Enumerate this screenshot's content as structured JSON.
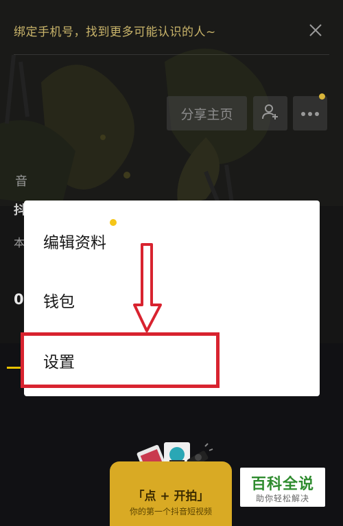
{
  "banner": {
    "text": "绑定手机号，找到更多可能认识的人~",
    "close_icon": "close-icon"
  },
  "actions": {
    "share_label": "分享主页",
    "add_friend_icon": "add-friend-icon",
    "more_icon": "more-icon"
  },
  "profile": {
    "fragments": [
      "音",
      "抖",
      "本",
      "0"
    ]
  },
  "menu": {
    "items": [
      {
        "label": "编辑资料"
      },
      {
        "label": "钱包"
      },
      {
        "label": "设置"
      }
    ]
  },
  "bottom_card": {
    "title": "「点 + 开拍」",
    "subtitle": "你的第一个抖音短视频"
  },
  "watermark": {
    "title": "百科全说",
    "subtitle": "助你轻松解决"
  },
  "colors": {
    "accent": "#f5c618",
    "highlight": "#d8232f"
  }
}
